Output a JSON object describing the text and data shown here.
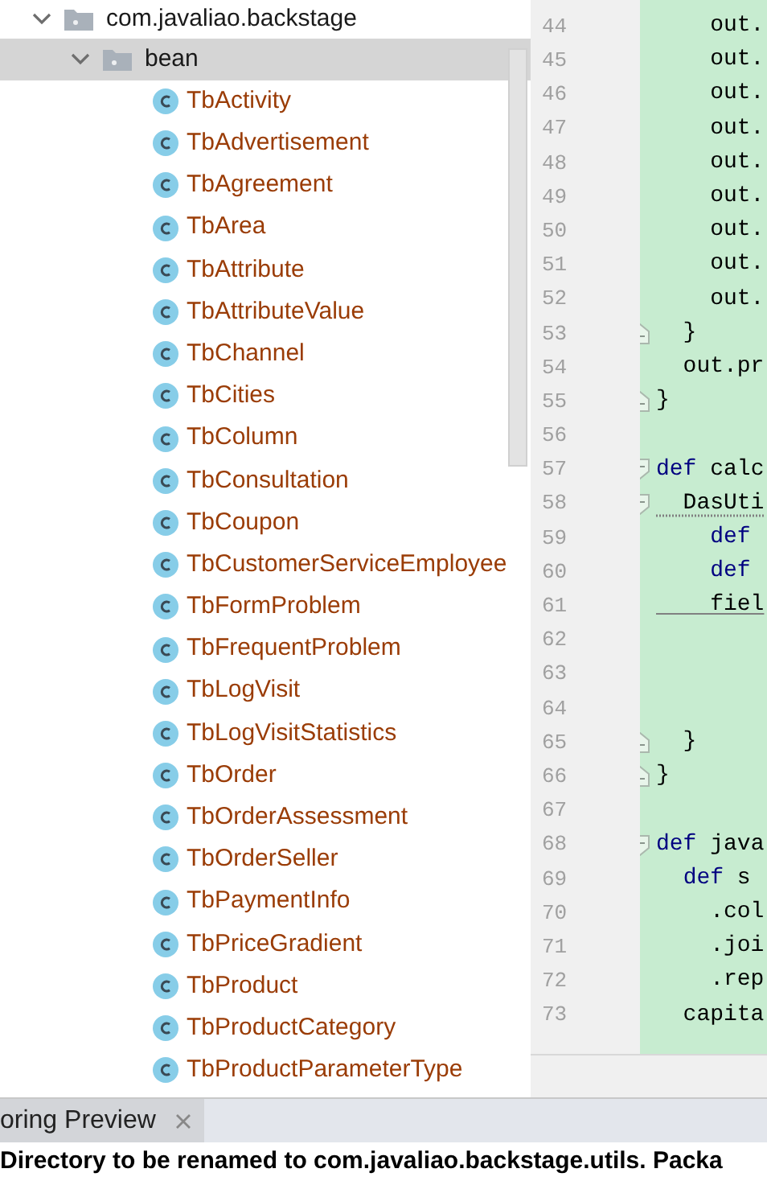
{
  "tree": {
    "root": {
      "label": "com.javaliao.backstage",
      "expanded": true,
      "children": [
        {
          "label": "bean",
          "expanded": true,
          "selected": true,
          "children": [
            {
              "label": "TbActivity"
            },
            {
              "label": "TbAdvertisement"
            },
            {
              "label": "TbAgreement"
            },
            {
              "label": "TbArea"
            },
            {
              "label": "TbAttribute"
            },
            {
              "label": "TbAttributeValue"
            },
            {
              "label": "TbChannel"
            },
            {
              "label": "TbCities"
            },
            {
              "label": "TbColumn"
            },
            {
              "label": "TbConsultation"
            },
            {
              "label": "TbCoupon"
            },
            {
              "label": "TbCustomerServiceEmployee"
            },
            {
              "label": "TbFormProblem"
            },
            {
              "label": "TbFrequentProblem"
            },
            {
              "label": "TbLogVisit"
            },
            {
              "label": "TbLogVisitStatistics"
            },
            {
              "label": "TbOrder"
            },
            {
              "label": "TbOrderAssessment"
            },
            {
              "label": "TbOrderSeller"
            },
            {
              "label": "TbPaymentInfo"
            },
            {
              "label": "TbPriceGradient"
            },
            {
              "label": "TbProduct"
            },
            {
              "label": "TbProductCategory"
            },
            {
              "label": "TbProductParameterType"
            }
          ]
        }
      ]
    }
  },
  "editor": {
    "lines": [
      {
        "number": "44",
        "text": "    out."
      },
      {
        "number": "45",
        "text": "    out."
      },
      {
        "number": "46",
        "text": "    out."
      },
      {
        "number": "47",
        "text": "    out."
      },
      {
        "number": "48",
        "text": "    out."
      },
      {
        "number": "49",
        "text": "    out."
      },
      {
        "number": "50",
        "text": "    out."
      },
      {
        "number": "51",
        "text": "    out."
      },
      {
        "number": "52",
        "text": "    out."
      },
      {
        "number": "53",
        "text": "  }",
        "fold_end": true
      },
      {
        "number": "54",
        "text": "  out.pr"
      },
      {
        "number": "55",
        "text": "}",
        "fold_end": true
      },
      {
        "number": "56"
      },
      {
        "number": "57",
        "text": "**def** calc",
        "fold_start": true
      },
      {
        "number": "58",
        "text": "  DasUti",
        "fold_start": true,
        "dotted_underline": true
      },
      {
        "number": "59",
        "text": "    **def** "
      },
      {
        "number": "60",
        "text": "    **def** "
      },
      {
        "number": "61",
        "text": "    fiel",
        "solid_underline": true
      },
      {
        "number": "62"
      },
      {
        "number": "63"
      },
      {
        "number": "64"
      },
      {
        "number": "65",
        "text": "  }",
        "fold_end": true
      },
      {
        "number": "66",
        "text": "}",
        "fold_end": true
      },
      {
        "number": "67"
      },
      {
        "number": "68",
        "text": "**def** java",
        "fold_start": true
      },
      {
        "number": "69",
        "text": "  **def** s "
      },
      {
        "number": "70",
        "text": "    .col"
      },
      {
        "number": "71",
        "text": "    .joi"
      },
      {
        "number": "72",
        "text": "    .rep"
      },
      {
        "number": "73",
        "text": "  capita"
      }
    ]
  },
  "bottom_panel": {
    "tab": {
      "label": "oring Preview",
      "closable": true
    },
    "message": "Directory to be renamed to com.javaliao.backstage.utils. Packa"
  }
}
